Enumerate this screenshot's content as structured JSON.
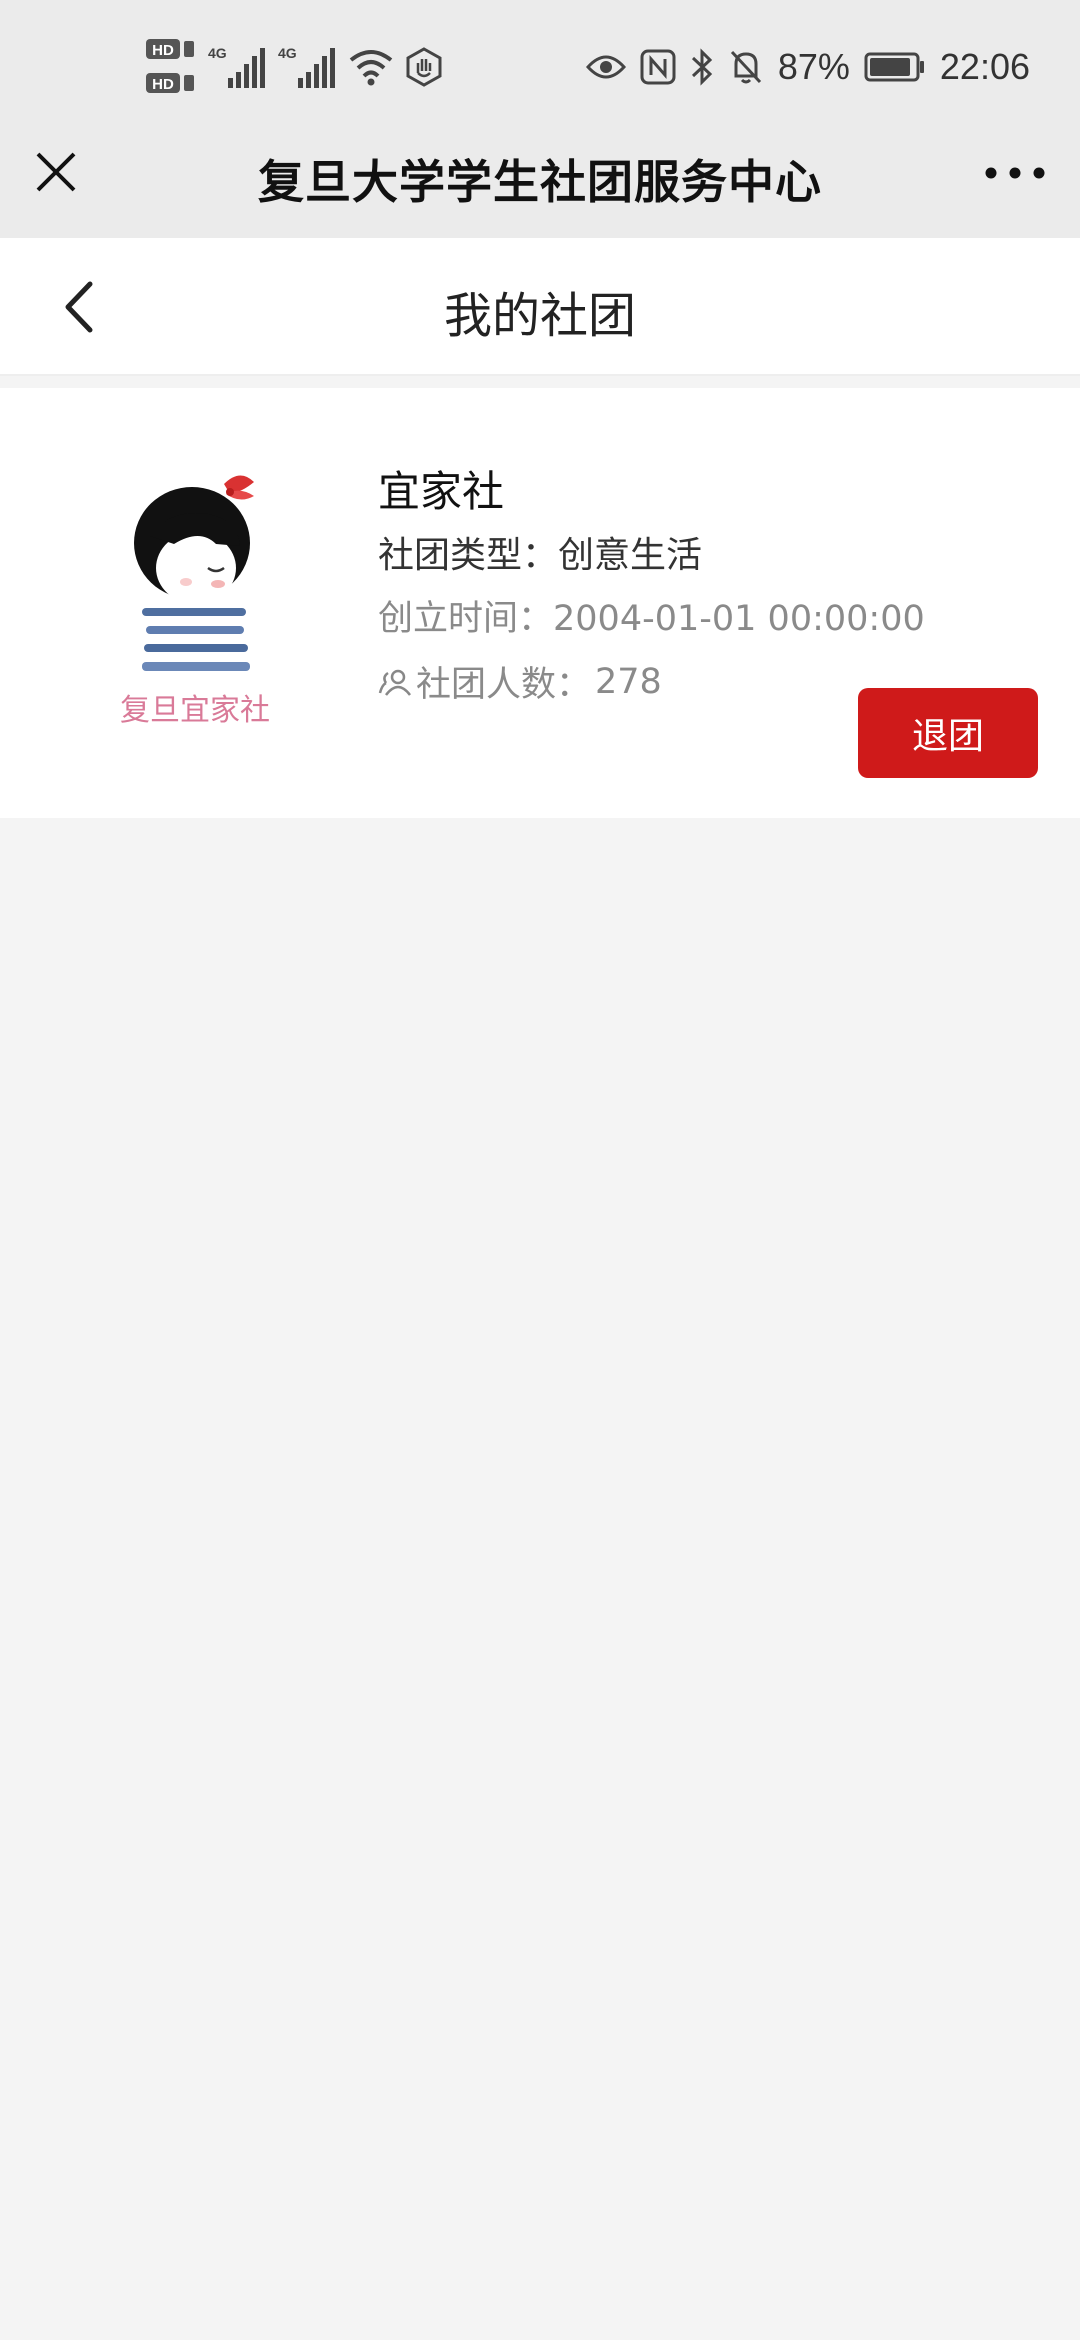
{
  "status_bar": {
    "left_labels": {
      "hd1": "HD",
      "hd2": "HD",
      "net1": "4G",
      "net2": "4G"
    },
    "battery_percent": "87%",
    "time": "22:06",
    "icons": [
      "hd-icon",
      "signal-icon",
      "wifi-icon",
      "hand-icon",
      "eye-icon",
      "nfc-icon",
      "bluetooth-icon",
      "mute-icon",
      "battery-icon"
    ]
  },
  "wechat_header": {
    "title": "复旦大学学生社团服务中心",
    "close_icon": "close-icon",
    "more_icon": "more-icon"
  },
  "page": {
    "title": "我的社团",
    "back_icon": "chevron-left-icon"
  },
  "club": {
    "name": "宜家社",
    "type_label": "社团类型：",
    "type_value": "创意生活",
    "founded_label": "创立时间：",
    "founded_value": "2004-01-01 00:00:00",
    "members_label": "社团人数：",
    "members_value": "278",
    "logo_text": "复旦宜家社",
    "leave_button": "退团"
  },
  "colors": {
    "accent_red": "#cf1a1a",
    "header_bg": "#ebebeb",
    "page_bg": "#f4f4f4"
  }
}
